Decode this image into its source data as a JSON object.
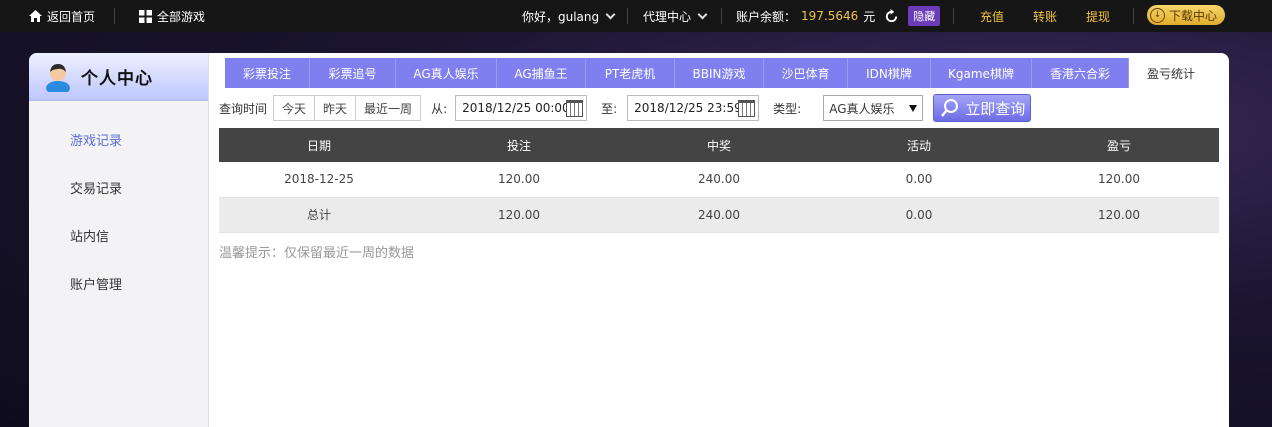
{
  "topbar": {
    "home": "返回首页",
    "all_games": "全部游戏",
    "greeting": "你好，gulang",
    "agent_center": "代理中心",
    "balance_label": "账户余额：",
    "balance_value": "197.5646",
    "balance_unit": "元",
    "hide": "隐藏",
    "recharge": "充值",
    "transfer": "转账",
    "withdraw": "提现",
    "download": "下载中心"
  },
  "sidebar": {
    "title": "个人中心",
    "items": [
      {
        "label": "游戏记录",
        "active": true
      },
      {
        "label": "交易记录"
      },
      {
        "label": "站内信"
      },
      {
        "label": "账户管理"
      }
    ]
  },
  "tabs": [
    {
      "label": "彩票投注"
    },
    {
      "label": "彩票追号"
    },
    {
      "label": "AG真人娱乐"
    },
    {
      "label": "AG捕鱼王"
    },
    {
      "label": "PT老虎机"
    },
    {
      "label": "BBIN游戏"
    },
    {
      "label": "沙巴体育"
    },
    {
      "label": "IDN棋牌"
    },
    {
      "label": "Kgame棋牌"
    },
    {
      "label": "香港六合彩"
    },
    {
      "label": "盈亏统计",
      "active": true
    }
  ],
  "query": {
    "label": "查询时间",
    "quick": [
      "今天",
      "昨天",
      "最近一周"
    ],
    "from_label": "从:",
    "from_value": "2018/12/25 00:00",
    "to_label": "至:",
    "to_value": "2018/12/25 23:59",
    "type_label": "类型:",
    "type_value": "AG真人娱乐",
    "search_button": "立即查询"
  },
  "table": {
    "headers": [
      "日期",
      "投注",
      "中奖",
      "活动",
      "盈亏"
    ],
    "rows": [
      [
        "2018-12-25",
        "120.00",
        "240.00",
        "0.00",
        "120.00"
      ]
    ],
    "total": [
      "总计",
      "120.00",
      "240.00",
      "0.00",
      "120.00"
    ]
  },
  "tip": "温馨提示：仅保留最近一周的数据",
  "colors": {
    "tab": "#7f7ff0",
    "accent_gold": "#f3c445",
    "header_dark": "#444444",
    "active_menu": "#5b6ad6"
  }
}
